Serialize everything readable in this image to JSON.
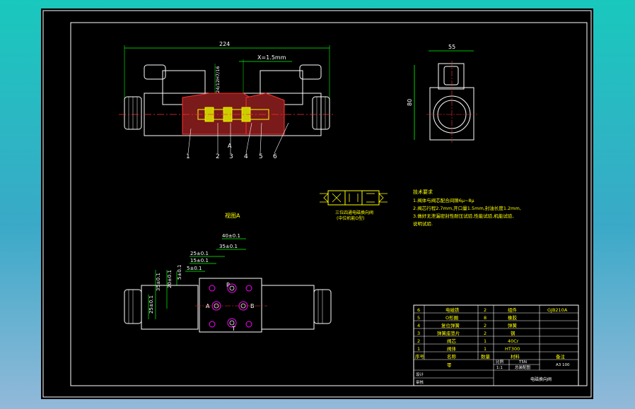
{
  "front_view": {
    "overall_width_dim": "224",
    "stroke_dim": "X=1.5mm",
    "slot_dim": "φ24/12H7/16",
    "section_label": "A",
    "balloons": [
      "1",
      "2",
      "3",
      "4",
      "5",
      "6"
    ],
    "balloon_mid": "3"
  },
  "side_view": {
    "width_dim": "55",
    "height_dim": "80"
  },
  "symbol": {
    "caption_line1": "三位四通电磁换向阀",
    "caption_line2": "(中位机能O型)"
  },
  "tech_req": {
    "title": "技术要求",
    "lines": [
      "1.阀体与阀芯配合间隙6μ~8μ",
      "2.阀芯行程2.7mm,开口量1.5mm,封油长度1.2mm,",
      "3.做好无泄漏密封性耐压试验,性能试验,机能试验,",
      "说明试验."
    ]
  },
  "bottom_view": {
    "title": "视图A",
    "dims_h": [
      "40±0.1",
      "35±0.1",
      "25±0.1",
      "15±0.1",
      "5±0.1"
    ],
    "dims_v": [
      "35±0.1",
      "20±0.1",
      "5±0.1",
      "25±0.1"
    ],
    "ports": {
      "p": "P",
      "a": "A",
      "b": "B",
      "t": "T"
    }
  },
  "title_block": {
    "bom_rows": [
      {
        "no": "6",
        "name": "电磁铁",
        "qty": "2",
        "material": "组件",
        "note": "GJB210A"
      },
      {
        "no": "5",
        "name": "O形圈",
        "qty": "8",
        "material": "橡胶",
        "note": ""
      },
      {
        "no": "4",
        "name": "复位弹簧",
        "qty": "2",
        "material": "弹簧",
        "note": ""
      },
      {
        "no": "3",
        "name": "弹簧座垫片",
        "qty": "2",
        "material": "钢",
        "note": ""
      },
      {
        "no": "2",
        "name": "阀芯",
        "qty": "1",
        "material": "40Cr",
        "note": ""
      },
      {
        "no": "1",
        "name": "阀体",
        "qty": "1",
        "material": "HT300",
        "note": ""
      }
    ],
    "header": {
      "no": "序号",
      "name": "名称",
      "qty": "数量",
      "material": "材料",
      "note": "备注"
    },
    "scale_label": "比例",
    "scale_value": "1:1",
    "sheet_label": "共1张",
    "mass": "T5N",
    "drawing_no": "电磁换向阀",
    "assembly": "总装配图",
    "designer": "设计",
    "checker": "审核",
    "code": "A3 100",
    "name_row": "零"
  }
}
